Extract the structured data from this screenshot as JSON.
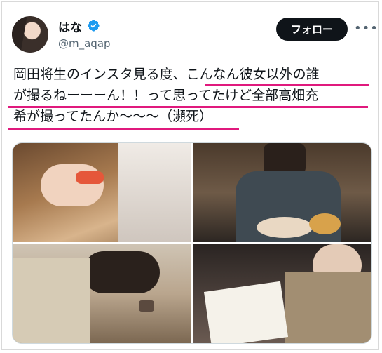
{
  "user": {
    "display_name": "はな",
    "handle": "@m_aqap",
    "verified": true
  },
  "actions": {
    "follow_label": "フォロー",
    "more_label": "•••"
  },
  "tweet": {
    "lines": [
      "岡田将生のインスタ見る度、こんなん彼女以外の誰",
      "が撮るねーーーん！！って思ってたけど全部高畑充",
      "希が撮ってたんか〜〜〜（瀕死）"
    ]
  },
  "media": {
    "photo_count": 4,
    "photos": [
      {
        "name": "photo-sushi"
      },
      {
        "name": "photo-man-eating-soup"
      },
      {
        "name": "photo-man-drinking"
      },
      {
        "name": "photo-man-reading-menu"
      }
    ]
  },
  "colors": {
    "highlight_underline": "#e0197d",
    "verified_badge": "#1d9bf0",
    "follow_button": "#0f1419"
  }
}
